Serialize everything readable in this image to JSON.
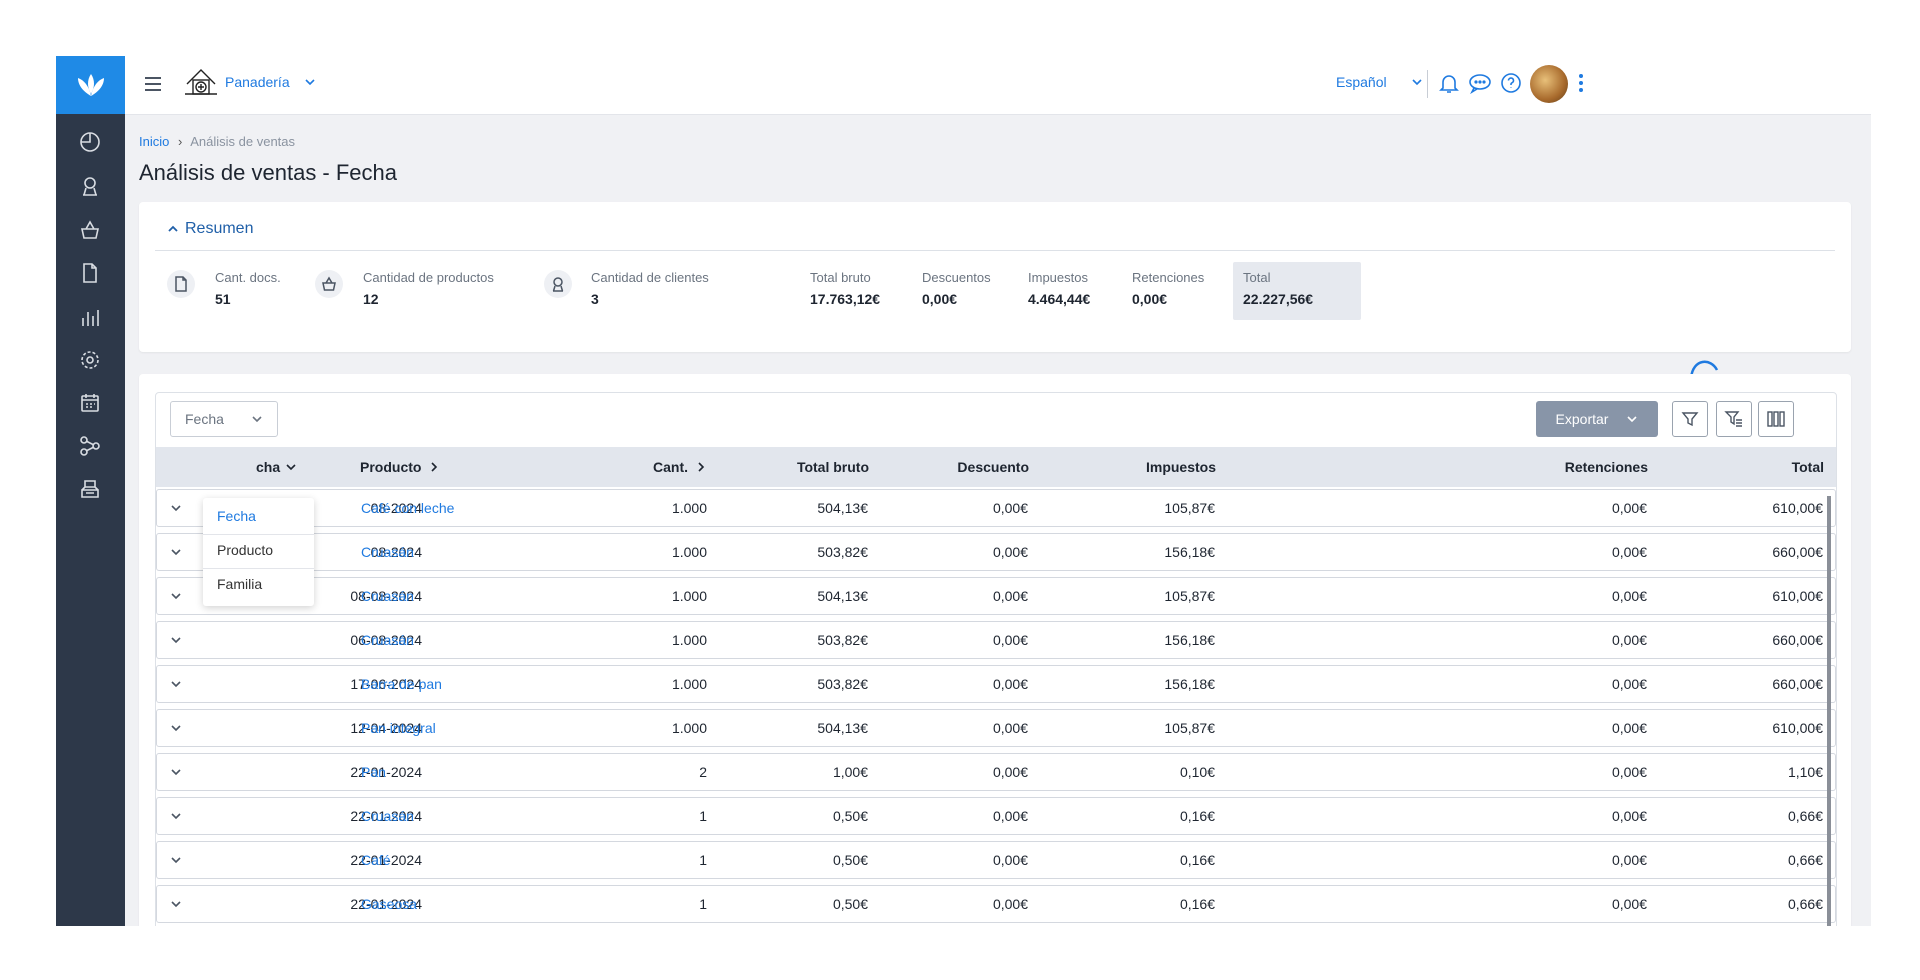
{
  "header": {
    "company": "Panadería",
    "language": "Español"
  },
  "breadcrumb": {
    "home": "Inicio",
    "separator": "›",
    "current": "Análisis de ventas"
  },
  "page_title": "Análisis de ventas - Fecha",
  "summary": {
    "toggle_label": "Resumen",
    "metrics": [
      {
        "label": "Cant. docs.",
        "value": "51"
      },
      {
        "label": "Cantidad de productos",
        "value": "12"
      },
      {
        "label": "Cantidad de clientes",
        "value": "3"
      },
      {
        "label": "Total bruto",
        "value": "17.763,12€"
      },
      {
        "label": "Descuentos",
        "value": "0,00€"
      },
      {
        "label": "Impuestos",
        "value": "4.464,44€"
      },
      {
        "label": "Retenciones",
        "value": "0,00€"
      },
      {
        "label": "Total",
        "value": "22.227,56€"
      }
    ]
  },
  "toolbar": {
    "group_by_value": "Fecha",
    "group_by_options": [
      "Fecha",
      "Producto",
      "Familia"
    ],
    "export_label": "Exportar"
  },
  "table": {
    "columns": [
      "Fecha",
      "Producto",
      "Cant.",
      "Total bruto",
      "Descuento",
      "Impuestos",
      "Retenciones",
      "Total"
    ],
    "visible_date_header": "cha",
    "rows": [
      {
        "fecha": "08-2024",
        "producto": "Café con leche",
        "cant": "1.000",
        "bruto": "504,13€",
        "descuento": "0,00€",
        "impuestos": "105,87€",
        "retenciones": "0,00€",
        "total": "610,00€"
      },
      {
        "fecha": "08-2024",
        "producto": "Cruasán",
        "cant": "1.000",
        "bruto": "503,82€",
        "descuento": "0,00€",
        "impuestos": "156,18€",
        "retenciones": "0,00€",
        "total": "660,00€"
      },
      {
        "fecha": "08-08-2024",
        "producto": "Cruasán",
        "cant": "1.000",
        "bruto": "504,13€",
        "descuento": "0,00€",
        "impuestos": "105,87€",
        "retenciones": "0,00€",
        "total": "610,00€"
      },
      {
        "fecha": "06-08-2024",
        "producto": "Cruasán",
        "cant": "1.000",
        "bruto": "503,82€",
        "descuento": "0,00€",
        "impuestos": "156,18€",
        "retenciones": "0,00€",
        "total": "660,00€"
      },
      {
        "fecha": "17-06-2024",
        "producto": "Barra de pan",
        "cant": "1.000",
        "bruto": "503,82€",
        "descuento": "0,00€",
        "impuestos": "156,18€",
        "retenciones": "0,00€",
        "total": "660,00€"
      },
      {
        "fecha": "12-04-2024",
        "producto": "Pan integral",
        "cant": "1.000",
        "bruto": "504,13€",
        "descuento": "0,00€",
        "impuestos": "105,87€",
        "retenciones": "0,00€",
        "total": "610,00€"
      },
      {
        "fecha": "22-01-2024",
        "producto": "Pan",
        "cant": "2",
        "bruto": "1,00€",
        "descuento": "0,00€",
        "impuestos": "0,10€",
        "retenciones": "0,00€",
        "total": "1,10€"
      },
      {
        "fecha": "22-01-2024",
        "producto": "Cruasán",
        "cant": "1",
        "bruto": "0,50€",
        "descuento": "0,00€",
        "impuestos": "0,16€",
        "retenciones": "0,00€",
        "total": "0,66€"
      },
      {
        "fecha": "22-01-2024",
        "producto": "Café",
        "cant": "1",
        "bruto": "0,50€",
        "descuento": "0,00€",
        "impuestos": "0,16€",
        "retenciones": "0,00€",
        "total": "0,66€"
      },
      {
        "fecha": "22-01-2024",
        "producto": "Gaseosa",
        "cant": "1",
        "bruto": "0,50€",
        "descuento": "0,00€",
        "impuestos": "0,16€",
        "retenciones": "0,00€",
        "total": "0,66€"
      }
    ]
  },
  "colors": {
    "accent": "#1f7ae0",
    "sidebar": "#2d3849",
    "logo_bg": "#1f8ae6"
  },
  "icons": {
    "sidebar": [
      "dashboard-icon",
      "user-icon",
      "basket-icon",
      "document-icon",
      "bar-chart-icon",
      "gear-icon",
      "calendar-icon",
      "network-icon",
      "printer-icon"
    ],
    "topbar": [
      "menu-icon",
      "company-logo",
      "chevron-down-icon",
      "bell-icon",
      "chat-icon",
      "help-icon",
      "avatar",
      "more-vertical-icon"
    ],
    "tools": [
      "filter-icon",
      "advanced-filter-icon",
      "columns-icon"
    ]
  }
}
